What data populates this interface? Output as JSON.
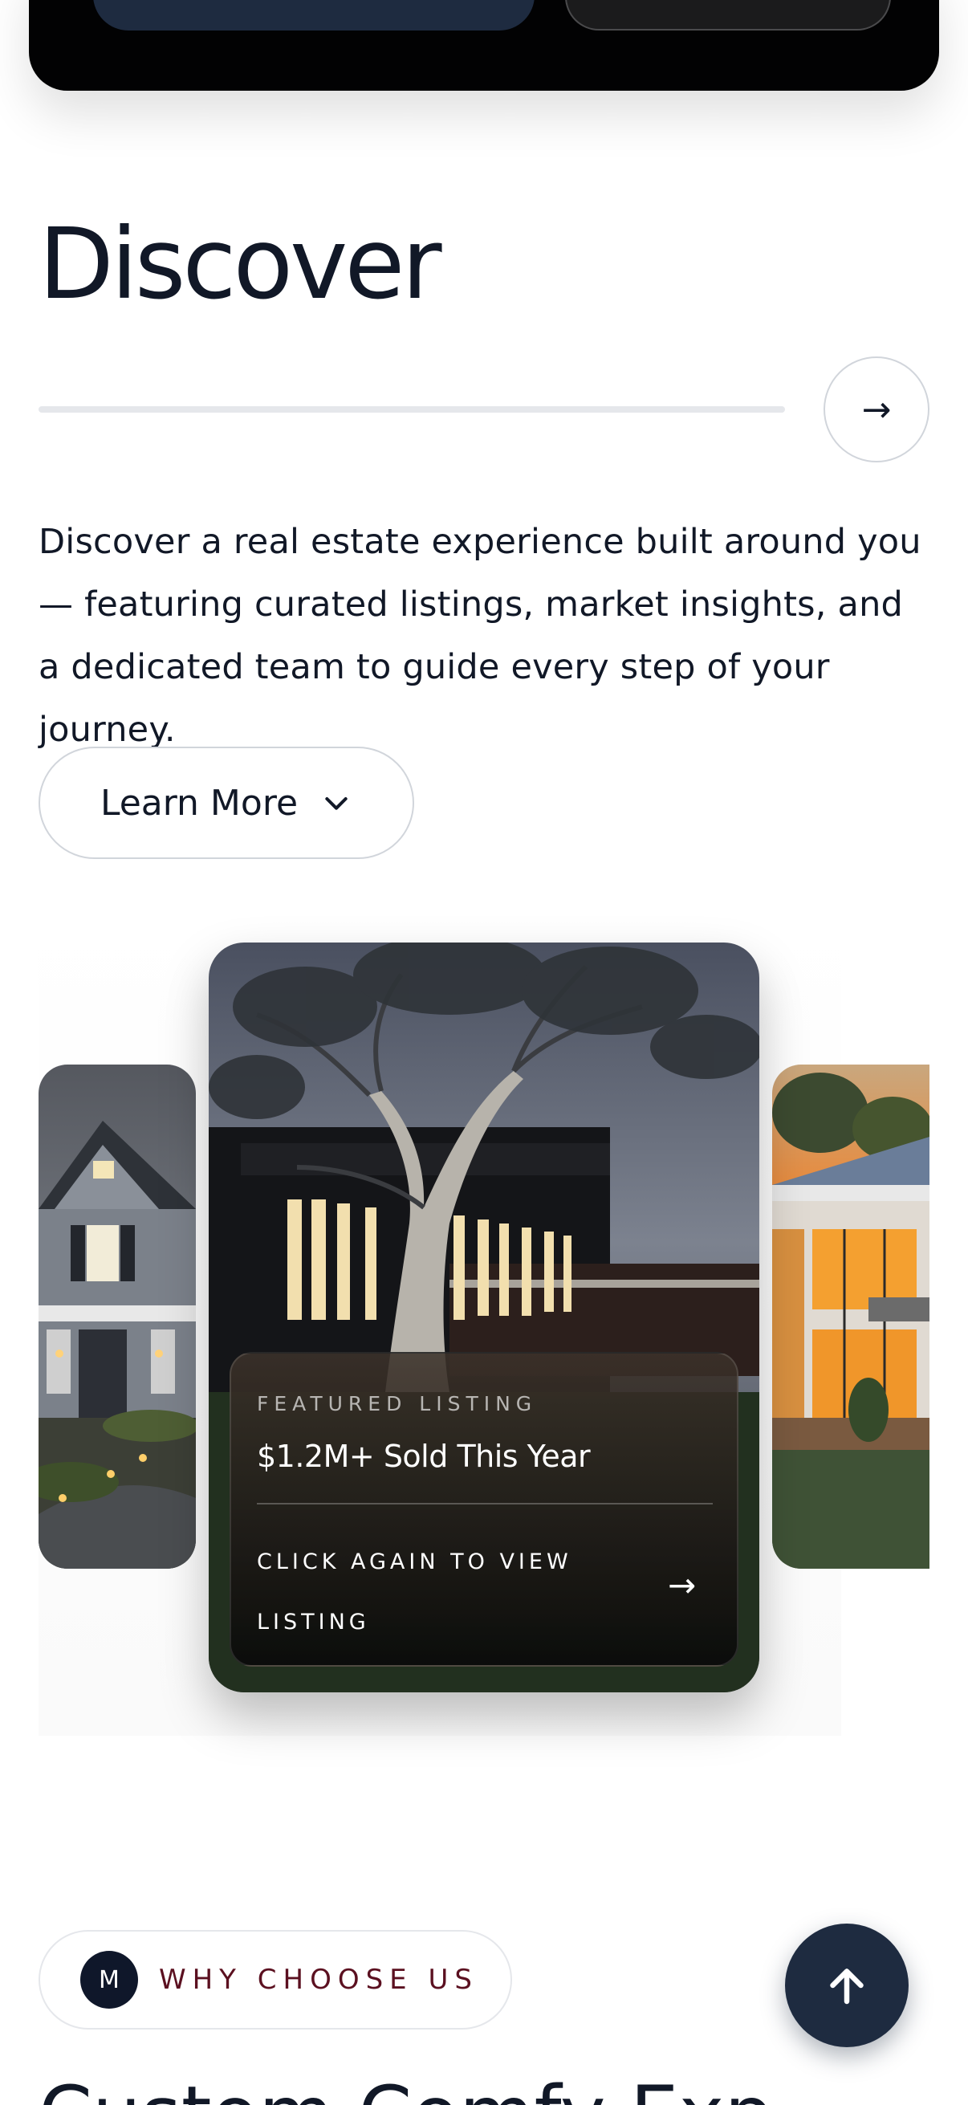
{
  "discover": {
    "heading": "Discover",
    "description": "Discover a real estate experience built around you — featuring curated listings, market insights, and a dedicated team to guide every step of your journey.",
    "learn_more_label": "Learn More",
    "arrow_glyph": "→"
  },
  "featured": {
    "eyebrow": "FEATURED LISTING",
    "title": "$1.2M+ Sold This Year",
    "cta": "CLICK AGAIN TO VIEW LISTING",
    "arrow_glyph": "→"
  },
  "why_choose": {
    "badge": "M",
    "label": "WHY CHOOSE US"
  },
  "next_section": {
    "heading_partial": "Custom Comfy Exp"
  },
  "icons": {
    "next": "arrow-right-icon",
    "dropdown": "chevron-down-icon",
    "scroll_top": "arrow-up-icon"
  },
  "colors": {
    "navy": "#1e2b40",
    "maroon_text": "#5b1020"
  }
}
